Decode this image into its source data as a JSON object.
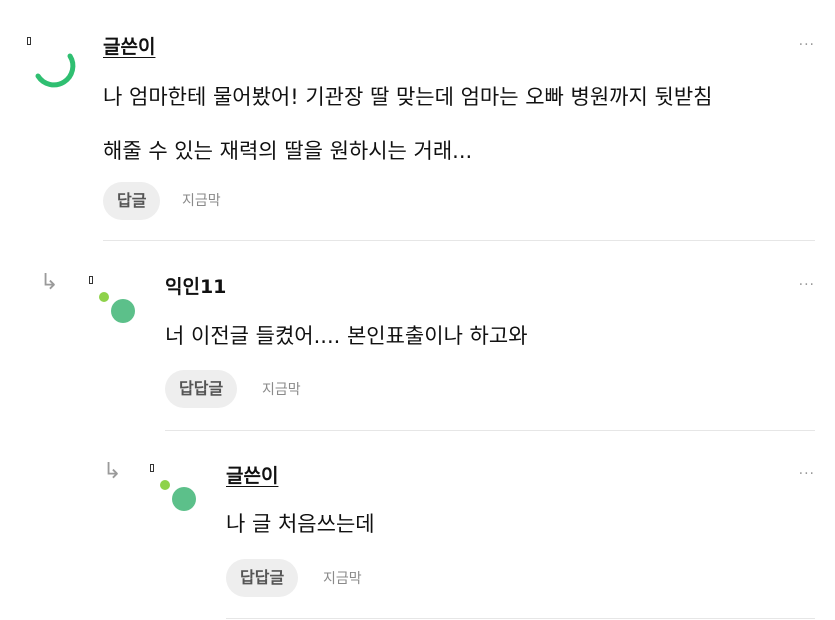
{
  "comments": [
    {
      "author": "글쓴이",
      "body_line1": "나 엄마한테 물어봤어! 기관장 딸 맞는데 엄마는 오빠 병원까지 뒷받침",
      "body_line2": "해줄 수 있는 재력의 딸을 원하시는 거래...",
      "reply_label": "답글",
      "time": "지금막",
      "more": "···"
    },
    {
      "author": "익인11",
      "body_line1": "너 이전글 들켰어.... 본인표출이나 하고와",
      "reply_label": "답답글",
      "time": "지금막",
      "more": "···",
      "reply_marker": "↳"
    },
    {
      "author": "글쓴이",
      "body_line1": "나 글 처음쓰는데",
      "reply_label": "답답글",
      "time": "지금막",
      "more": "···",
      "reply_marker": "↳"
    }
  ],
  "colors": {
    "accent_green": "#2fbf71",
    "avatar_green": "#5cc08a",
    "dot_lime": "#8ed24a"
  }
}
